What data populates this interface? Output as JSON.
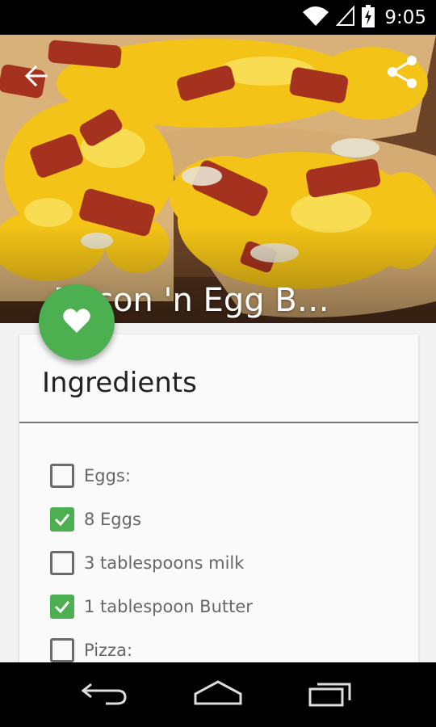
{
  "status_bar": {
    "time": "9:05",
    "icons": [
      "wifi-icon",
      "signal-icon",
      "battery-charging-icon"
    ]
  },
  "app_bar": {
    "back_icon": "arrow-back-icon",
    "share_icon": "share-icon",
    "title": "Bacon 'n Egg B…"
  },
  "fab": {
    "icon": "heart-icon",
    "color": "#4caf50"
  },
  "ingredients": {
    "heading": "Ingredients",
    "items": [
      {
        "label": "Eggs:",
        "checked": false
      },
      {
        "label": "8 Eggs",
        "checked": true
      },
      {
        "label": "3 tablespoons milk",
        "checked": false
      },
      {
        "label": "1 tablespoon Butter",
        "checked": true
      },
      {
        "label": "Pizza:",
        "checked": false
      }
    ]
  },
  "nav_bar": {
    "buttons": [
      "back-nav-icon",
      "home-nav-icon",
      "recents-nav-icon"
    ]
  },
  "colors": {
    "accent": "#4caf50"
  }
}
